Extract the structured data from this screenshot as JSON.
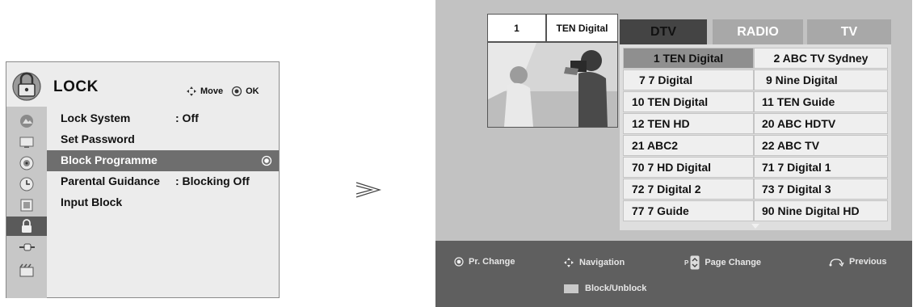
{
  "lock_menu": {
    "title": "LOCK",
    "hint_move": "Move",
    "hint_ok": "OK",
    "sidebar_icons": [
      "picture-icon",
      "monitor-icon",
      "audio-icon",
      "clock-icon",
      "setup-icon",
      "lock-icon",
      "input-icon",
      "tv-guide-icon"
    ],
    "items": [
      {
        "label": "Lock System",
        "value": ": Off"
      },
      {
        "label": "Set Password",
        "value": ""
      },
      {
        "label": "Block Programme",
        "value": ""
      },
      {
        "label": "Parental Guidance",
        "value": ": Blocking Off"
      },
      {
        "label": "Input Block",
        "value": ""
      }
    ],
    "selected_index": 2
  },
  "programme_panel": {
    "channel_number": "1",
    "channel_name": "TEN Digital",
    "tabs": [
      "DTV",
      "RADIO",
      "TV"
    ],
    "active_tab": "DTV",
    "channels": [
      [
        "1 TEN Digital",
        "2 ABC TV Sydney"
      ],
      [
        "7 7 Digital",
        "9 Nine Digital"
      ],
      [
        "10 TEN Digital",
        "11 TEN Guide"
      ],
      [
        "12 TEN HD",
        "20 ABC HDTV"
      ],
      [
        "21 ABC2",
        "22 ABC TV"
      ],
      [
        "70 7 HD Digital",
        "71 7 Digital 1"
      ],
      [
        "72 7 Digital 2",
        "73 7 Digital 3"
      ],
      [
        "77 7 Guide",
        "90 Nine Digital HD"
      ]
    ],
    "highlighted_channel": "1 TEN Digital",
    "bottom_bar": {
      "pr_change": "Pr. Change",
      "navigation": "Navigation",
      "page_change": "Page Change",
      "page_prefix": "P",
      "previous": "Previous",
      "block_unblock": "Block/Unblock"
    }
  }
}
